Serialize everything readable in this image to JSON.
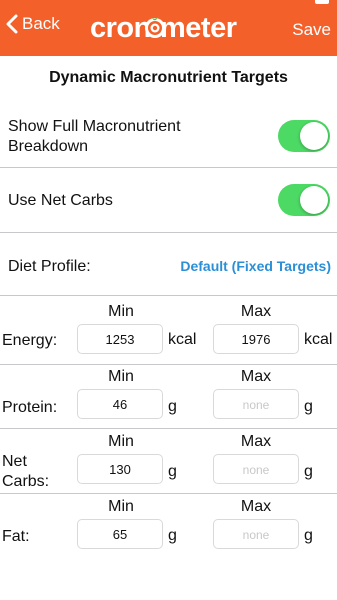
{
  "header": {
    "back_label": "Back",
    "save_label": "Save",
    "logo_left": "cron",
    "logo_right": "meter"
  },
  "title": "Dynamic Macronutrient Targets",
  "settings": {
    "full_breakdown_label_line1": "Show Full Macronutrient",
    "full_breakdown_label_line2": "Breakdown",
    "full_breakdown_on": true,
    "net_carbs_label": "Use Net Carbs",
    "net_carbs_on": true,
    "diet_profile_label": "Diet Profile:",
    "diet_profile_value": "Default (Fixed Targets)"
  },
  "columns": {
    "min": "Min",
    "max": "Max"
  },
  "targets": [
    {
      "name": "Energy:",
      "min": "1253",
      "min_unit": "kcal",
      "max": "1976",
      "max_unit": "kcal"
    },
    {
      "name": "Protein:",
      "min": "46",
      "min_unit": "g",
      "max_placeholder": "none",
      "max_unit": "g"
    },
    {
      "name_line1": "Net",
      "name_line2": "Carbs:",
      "min": "130",
      "min_unit": "g",
      "max_placeholder": "none",
      "max_unit": "g"
    },
    {
      "name": "Fat:",
      "min": "65",
      "min_unit": "g",
      "max_placeholder": "none",
      "max_unit": "g"
    }
  ],
  "colors": {
    "header_bg": "#f4602a",
    "toggle_on": "#4cd964",
    "link": "#2a8fd6"
  }
}
